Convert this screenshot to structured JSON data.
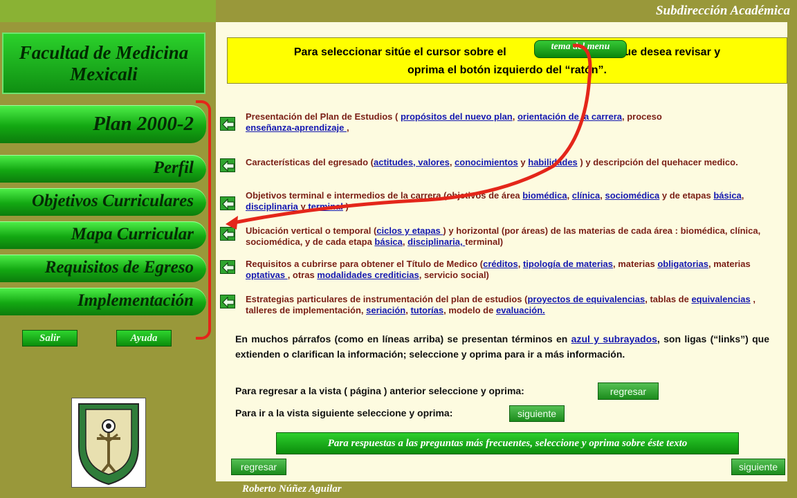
{
  "header": {
    "title": "Subdirección Académica"
  },
  "footer": {
    "author": "Roberto Núñez Aguilar"
  },
  "sidebar": {
    "faculty": [
      "Facultad de Medicina",
      "Mexicali"
    ],
    "nav": [
      "Plan 2000-2",
      "Perfil",
      "Objetivos Curriculares",
      "Mapa Curricular",
      "Requisitos de Egreso",
      "Implementación"
    ],
    "exit": "Salir",
    "help": "Ayuda"
  },
  "instructions": {
    "line1_pre": "Para seleccionar sitúe el cursor sobre el",
    "tema": "tema del menu",
    "line1_post": "que desea revisar y",
    "line2": "oprima el botón izquierdo del “ratón”."
  },
  "items": [
    {
      "pre": "Presentación del Plan de Estudios ( ",
      "l1": "propósitos del nuevo plan",
      "s1": ", ",
      "l2": "orientación de la carrera",
      "s2": ", proceso ",
      "l3": "enseñanza-aprendizaje ",
      "s3": ","
    },
    {
      "pre": "Características del egresado (",
      "l1": "actitudes, valores",
      "s1": ", ",
      "l2": "conocimientos",
      "s2": " y ",
      "l3": "habilidades",
      "s3": " ) y descripción del quehacer medico."
    },
    {
      "pre": "Objetivos terminal e intermedios de la carrera (objetivos de área ",
      "l1": "biomédica",
      "s1": ", ",
      "l2": "clínica",
      "s2": ", ",
      "l3": "sociomédica",
      "s3": " y de etapas ",
      "l4": "básica",
      "s4": ", ",
      "l5": "disciplinaria ",
      "s5": "y ",
      "l6": "terminal",
      "s6": " )"
    },
    {
      "pre": "Ubicación vertical o temporal  (",
      "l1": "ciclos y etapas ",
      "s1": ") y horizontal (por áreas) de las materias de cada área : biomédica, clínica, sociomédica, y de cada etapa ",
      "l2": "básica",
      "s2": ", ",
      "l3": "disciplinaria, ",
      "s3": "terminal)"
    },
    {
      "pre": "Requisitos a cubrirse para obtener el Título de Medico (",
      "l1": "créditos",
      "s1": ", ",
      "l2": "tipología de materias",
      "s2": ", materias ",
      "l3": "obligatorias",
      "s3": ", materias ",
      "l4": "optativas ",
      "s4": ", otras ",
      "l5": "modalidades crediticias",
      "s5": ", servicio social)"
    },
    {
      "pre": "Estrategias particulares de instrumentación del plan de estudios (",
      "l1": "proyectos de equivalencias",
      "s1": ", tablas de ",
      "l2": "equivalencias",
      "s2": " , talleres de implementación, ",
      "l3": "seriación",
      "s3": ", ",
      "l4": "tutorías",
      "s4": ", modelo de ",
      "l5": "evaluación.",
      "s5": ""
    }
  ],
  "links_note": {
    "pre": "En muchos párrafos (como en líneas arriba) se presentan términos en ",
    "link": "azul y subrayados",
    "post": ", son ligas (“links”) que extienden o clarifican la información; seleccione y oprima para ir a más información."
  },
  "nav_lines": {
    "back_text": "Para regresar a la vista ( página ) anterior seleccione y oprima:",
    "back_button": "regresar",
    "next_text": "Para ir a la vista siguiente seleccione y oprima:",
    "next_button": "siguiente"
  },
  "faq": "Para respuestas a las preguntas más frecuentes, seleccione y oprima sobre éste texto",
  "bottom_nav": {
    "back": "regresar",
    "next": "siguiente"
  },
  "colors": {
    "frame": "#99983a",
    "highlight": "#ffff00",
    "link": "#1418b0",
    "item_text": "#7a1f16",
    "accent_red": "#e4261a"
  }
}
